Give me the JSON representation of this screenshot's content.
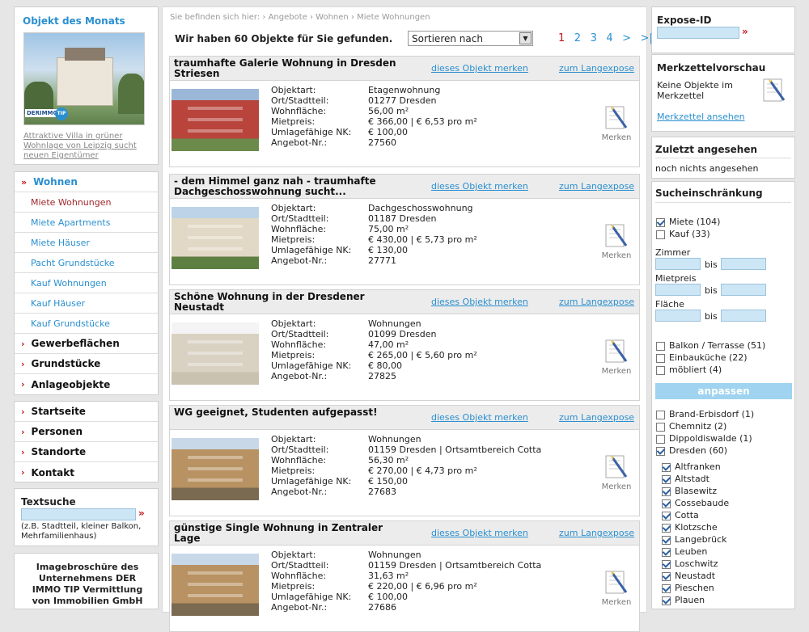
{
  "left": {
    "objekt_monat": {
      "title": "Objekt des Monats",
      "badge": "DERIMMO",
      "tip": "TIP",
      "caption": "Attraktive Villa in grüner Wohnlage von Leipzig sucht neuen Eigentümer"
    },
    "nav": {
      "wohnen": "Wohnen",
      "subs": [
        "Miete Wohnungen",
        "Miete Apartments",
        "Miete Häuser",
        "Pacht Grundstücke",
        "Kauf Wohnungen",
        "Kauf Häuser",
        "Kauf Grundstücke"
      ],
      "more": [
        "Gewerbeflächen",
        "Grundstücke",
        "Anlageobjekte"
      ]
    },
    "nav2": [
      "Startseite",
      "Personen",
      "Standorte",
      "Kontakt"
    ],
    "textsuche": {
      "title": "Textsuche",
      "hint": "(z.B. Stadtteil, kleiner Balkon, Mehrfamilienhaus)"
    },
    "broschuere": "Imagebroschüre des Unternehmens DER IMMO TIP Vermittlung von Immobilien GmbH"
  },
  "main": {
    "breadcrumb": [
      "Sie befinden sich hier:",
      "Angebote",
      "Wohnen",
      "Miete Wohnungen"
    ],
    "result": "Wir haben 60 Objekte für Sie gefunden.",
    "sort": "Sortieren nach",
    "pages": [
      "1",
      "2",
      "3",
      "4",
      ">",
      ">|"
    ],
    "merken_link": "dieses Objekt merken",
    "lang_link": "zum Langexpose",
    "merken_label": "Merken",
    "labels": [
      "Objektart:",
      "Ort/Stadtteil:",
      "Wohnfläche:",
      "Mietpreis:",
      "Umlagefähige NK:",
      "Angebot-Nr.:"
    ],
    "listings": [
      {
        "title": "traumhafte Galerie Wohnung in Dresden Striesen",
        "values": [
          "Etagenwohnung",
          "01277 Dresden",
          "56,00 m²",
          "€ 366,00 | € 6,53 pro m²",
          "€ 100,00",
          "27560"
        ]
      },
      {
        "title": "- dem Himmel ganz nah - traumhafte Dachgeschosswohnung sucht...",
        "values": [
          "Dachgeschosswohnung",
          "01187 Dresden",
          "75,00 m²",
          "€ 430,00 | € 5,73 pro m²",
          "€ 130,00",
          "27771"
        ]
      },
      {
        "title": "Schöne Wohnung in der Dresdener Neustadt",
        "values": [
          "Wohnungen",
          "01099 Dresden",
          "47,00 m²",
          "€ 265,00 | € 5,60 pro m²",
          "€ 80,00",
          "27825"
        ]
      },
      {
        "title": "WG geeignet, Studenten aufgepasst!",
        "values": [
          "Wohnungen",
          "01159 Dresden | Ortsamtbereich Cotta",
          "56,30 m²",
          "€ 270,00 | € 4,73 pro m²",
          "€ 150,00",
          "27683"
        ]
      },
      {
        "title": "günstige Single Wohnung in Zentraler Lage",
        "values": [
          "Wohnungen",
          "01159 Dresden | Ortsamtbereich Cotta",
          "31,63 m²",
          "€ 220,00 | € 6,96 pro m²",
          "€ 100,00",
          "27686"
        ]
      }
    ]
  },
  "right": {
    "expose": "Expose-ID",
    "merkzettel": {
      "title": "Merkzettelvorschau",
      "text": "Keine Objekte im Merkzettel",
      "link": "Merkzettel ansehen"
    },
    "zuletzt": {
      "title": "Zuletzt angesehen",
      "text": "noch nichts angesehen"
    },
    "such": {
      "title": "Sucheinschränkung",
      "type": [
        "Miete (104)",
        "Kauf (33)"
      ],
      "zimmer": "Zimmer",
      "miet": "Mietpreis",
      "flaeche": "Fläche",
      "bis": "bis",
      "extras": [
        "Balkon / Terrasse (51)",
        "Einbauküche (22)",
        "möbliert (4)"
      ],
      "anpassen": "anpassen",
      "orte": [
        "Brand-Erbisdorf (1)",
        "Chemnitz (2)",
        "Dippoldiswalde (1)",
        "Dresden (60)"
      ],
      "stadtteile": [
        "Altfranken",
        "Altstadt",
        "Blasewitz",
        "Cossebaude",
        "Cotta",
        "Klotzsche",
        "Langebrück",
        "Leuben",
        "Loschwitz",
        "Neustadt",
        "Pieschen",
        "Plauen"
      ]
    }
  }
}
